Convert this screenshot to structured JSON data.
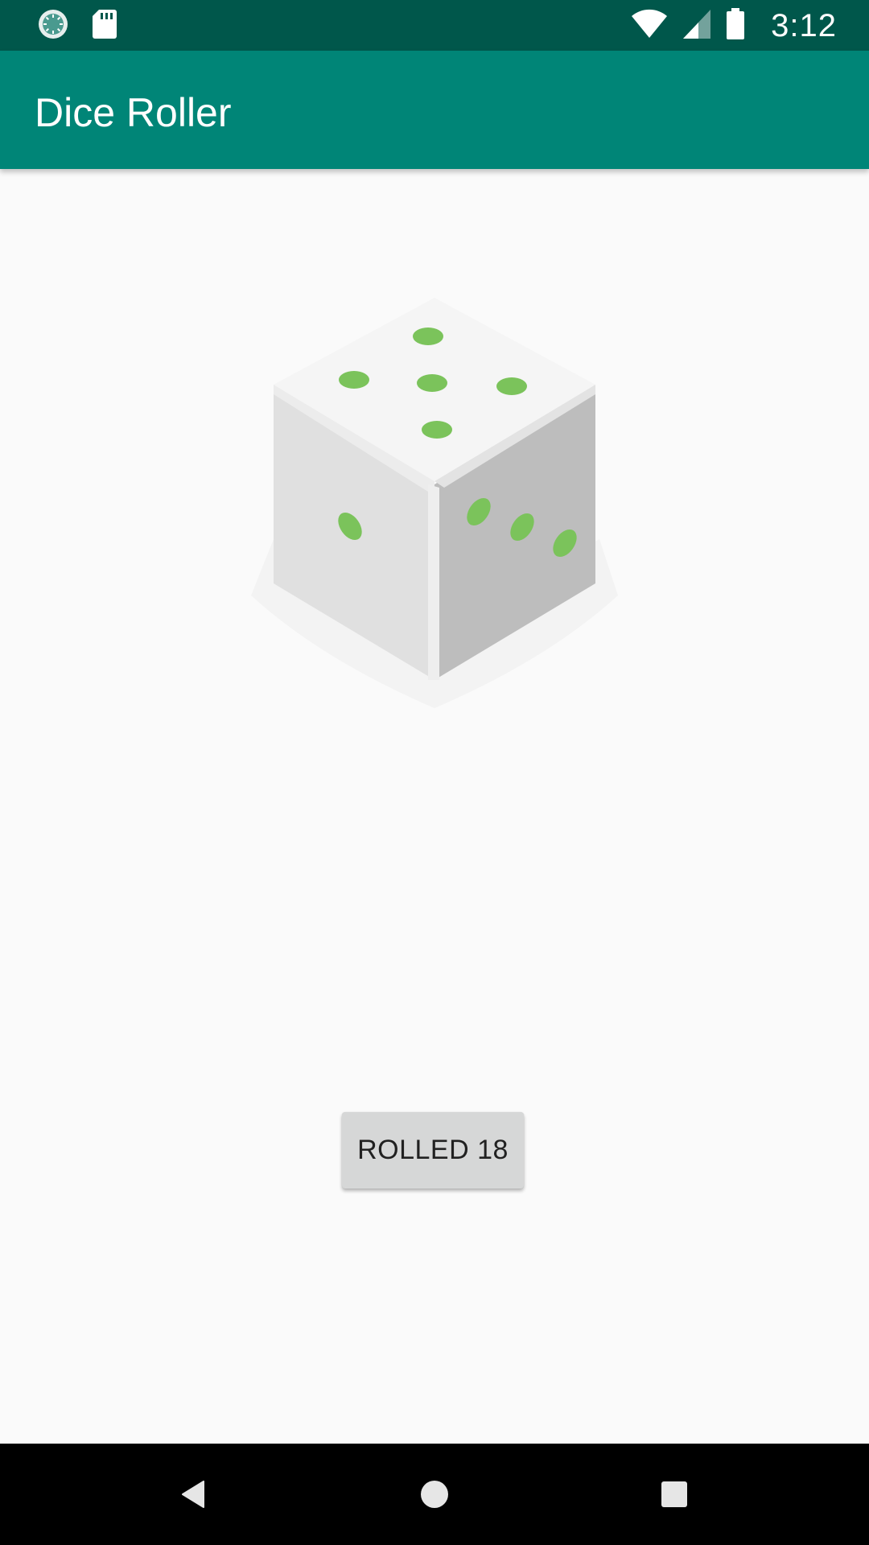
{
  "status_bar": {
    "time": "3:12",
    "icons": [
      "sync-icon",
      "sd-card-icon",
      "wifi-icon",
      "signal-icon",
      "battery-icon"
    ],
    "background_color": "#00574b"
  },
  "app_bar": {
    "title": "Dice Roller",
    "background_color": "#008577"
  },
  "main": {
    "dice": {
      "icon": "dice-icon",
      "pip_color": "#7bc35b"
    },
    "roll_button": {
      "label": "ROLLED 18"
    }
  },
  "nav_bar": {
    "icons": [
      "back-icon",
      "home-icon",
      "recents-icon"
    ]
  }
}
